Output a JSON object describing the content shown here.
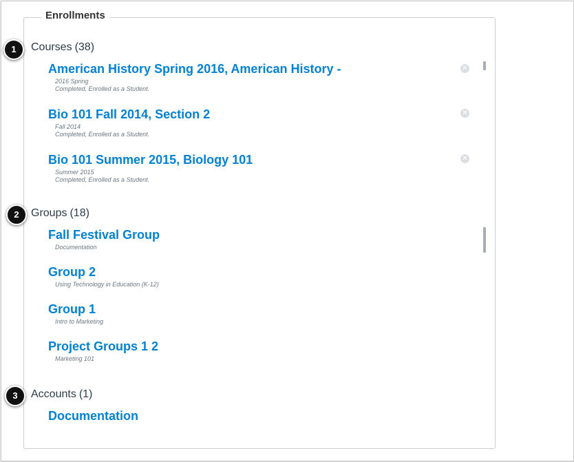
{
  "legend": "Enrollments",
  "badges": [
    "1",
    "2",
    "3"
  ],
  "courses": {
    "title": "Courses",
    "count": "(38)",
    "items": [
      {
        "title": "American History Spring 2016, American History -",
        "term": "2016 Spring",
        "status": "Completed, Enrolled as a Student."
      },
      {
        "title": "Bio 101 Fall 2014, Section 2",
        "term": "Fall 2014",
        "status": "Completed, Enrolled as a Student."
      },
      {
        "title": "Bio 101 Summer 2015, Biology 101",
        "term": "Summer 2015",
        "status": "Completed, Enrolled as a Student."
      }
    ]
  },
  "groups": {
    "title": "Groups",
    "count": "(18)",
    "items": [
      {
        "title": "Fall Festival Group",
        "context": "Documentation"
      },
      {
        "title": "Group 2",
        "context": "Using Technology in Education (K-12)"
      },
      {
        "title": "Group 1",
        "context": "Intro to Marketing"
      },
      {
        "title": "Project Groups 1 2",
        "context": "Marketing 101"
      }
    ]
  },
  "accounts": {
    "title": "Accounts",
    "count": "(1)",
    "items": [
      {
        "title": "Documentation"
      }
    ]
  },
  "icons": {
    "remove": "remove-circle-icon"
  },
  "colors": {
    "link": "#0081d4",
    "text": "#2d3b45",
    "badge": "#111111"
  }
}
